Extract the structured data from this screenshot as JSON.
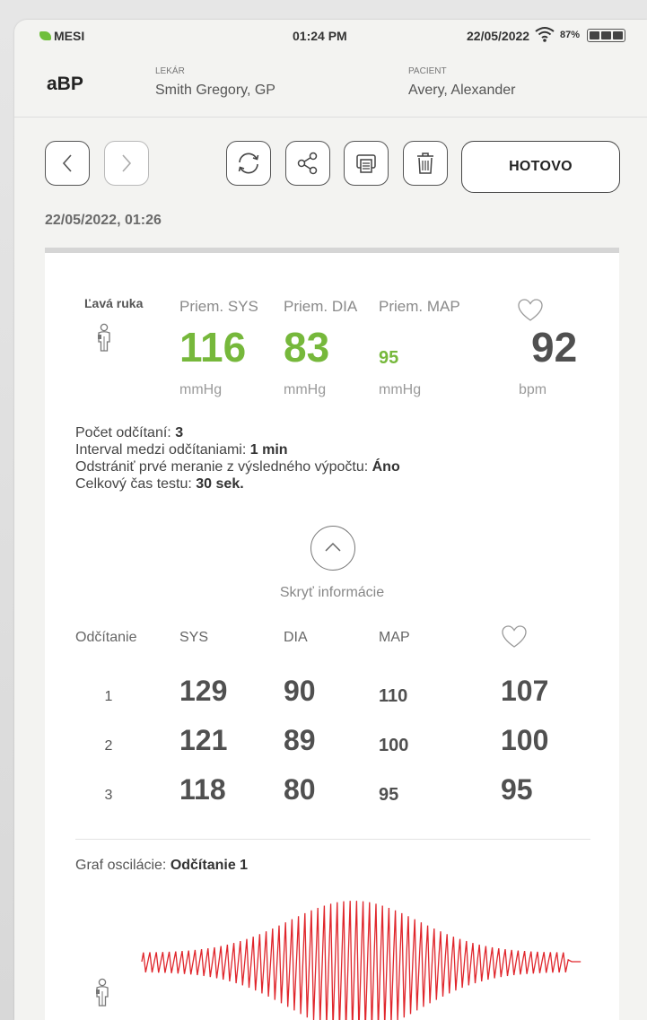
{
  "status": {
    "brand": "MESI",
    "time": "01:24 PM",
    "date": "22/05/2022",
    "battery": "87%",
    "icons": [
      "leaf-icon",
      "wifi-icon",
      "battery-icon"
    ]
  },
  "header": {
    "title": "aBP",
    "doctor_label": "LEKÁR",
    "doctor": "Smith Gregory, GP",
    "patient_label": "PACIENT",
    "patient": "Avery, Alexander"
  },
  "toolbar": {
    "done_label": "HOTOVO",
    "icons": [
      "chevron-left-icon",
      "chevron-right-icon",
      "refresh-icon",
      "share-icon",
      "print-icon",
      "trash-icon"
    ]
  },
  "timestamp": "22/05/2022, 01:26",
  "summary": {
    "arm": "Ľavá ruka",
    "sys_label": "Priem. SYS",
    "dia_label": "Priem. DIA",
    "map_label": "Priem. MAP",
    "sys": "116",
    "dia": "83",
    "map": "95",
    "hr": "92",
    "unit_mmhg": "mmHg",
    "unit_bpm": "bpm",
    "accent_color": "#76b83b"
  },
  "info": [
    {
      "label": "Počet odčítaní: ",
      "value": "3"
    },
    {
      "label": "Interval medzi odčítaniami: ",
      "value": "1 min"
    },
    {
      "label": "Odstrániť prvé meranie z výsledného výpočtu: ",
      "value": "Áno"
    },
    {
      "label": "Celkový čas testu: ",
      "value": "30 sek."
    }
  ],
  "hide_label": "Skryť informácie",
  "readings": {
    "headers": {
      "index": "Odčítanie",
      "sys": "SYS",
      "dia": "DIA",
      "map": "MAP"
    },
    "rows": [
      {
        "n": "1",
        "sys": "129",
        "dia": "90",
        "map": "110",
        "hr": "107"
      },
      {
        "n": "2",
        "sys": "121",
        "dia": "89",
        "map": "100",
        "hr": "100"
      },
      {
        "n": "3",
        "sys": "118",
        "dia": "80",
        "map": "95",
        "hr": "95"
      }
    ]
  },
  "graph": {
    "label": "Graf oscilácie: ",
    "reading": "Odčítanie 1",
    "color": "#e0262c"
  }
}
